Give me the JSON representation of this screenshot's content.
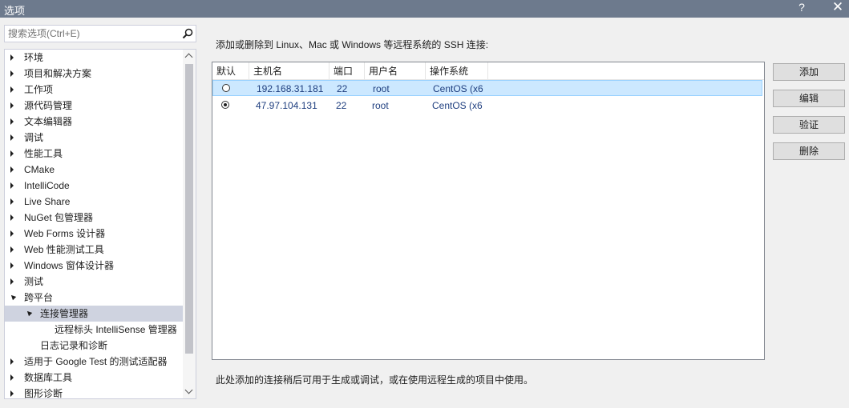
{
  "window": {
    "title": "选项",
    "help": "?",
    "close": "✕"
  },
  "search": {
    "placeholder": "搜索选项(Ctrl+E)",
    "value": ""
  },
  "tree": [
    {
      "label": "环境",
      "state": "collapsed",
      "level": 0
    },
    {
      "label": "项目和解决方案",
      "state": "collapsed",
      "level": 0
    },
    {
      "label": "工作项",
      "state": "collapsed",
      "level": 0
    },
    {
      "label": "源代码管理",
      "state": "collapsed",
      "level": 0
    },
    {
      "label": "文本编辑器",
      "state": "collapsed",
      "level": 0
    },
    {
      "label": "调试",
      "state": "collapsed",
      "level": 0
    },
    {
      "label": "性能工具",
      "state": "collapsed",
      "level": 0
    },
    {
      "label": "CMake",
      "state": "collapsed",
      "level": 0
    },
    {
      "label": "IntelliCode",
      "state": "collapsed",
      "level": 0
    },
    {
      "label": "Live Share",
      "state": "collapsed",
      "level": 0
    },
    {
      "label": "NuGet 包管理器",
      "state": "collapsed",
      "level": 0
    },
    {
      "label": "Web Forms 设计器",
      "state": "collapsed",
      "level": 0
    },
    {
      "label": "Web 性能测试工具",
      "state": "collapsed",
      "level": 0
    },
    {
      "label": "Windows 窗体设计器",
      "state": "collapsed",
      "level": 0
    },
    {
      "label": "测试",
      "state": "collapsed",
      "level": 0
    },
    {
      "label": "跨平台",
      "state": "expanded",
      "level": 0
    },
    {
      "label": "连接管理器",
      "state": "expanded",
      "level": 1,
      "selected": true
    },
    {
      "label": "远程标头 IntelliSense 管理器",
      "state": "none",
      "level": 2
    },
    {
      "label": "日志记录和诊断",
      "state": "none",
      "level": 1
    },
    {
      "label": "适用于 Google Test 的测试适配器",
      "state": "collapsed",
      "level": 0
    },
    {
      "label": "数据库工具",
      "state": "collapsed",
      "level": 0
    },
    {
      "label": "图形诊断",
      "state": "collapsed",
      "level": 0
    }
  ],
  "panel": {
    "description": "添加或删除到 Linux、Mac 或 Windows 等远程系统的 SSH 连接:",
    "columns": [
      "默认",
      "主机名",
      "端口",
      "用户名",
      "操作系统"
    ],
    "rows": [
      {
        "default": false,
        "host": "192.168.31.181",
        "port": "22",
        "user": "root",
        "os": "CentOS (x6",
        "selected": true
      },
      {
        "default": true,
        "host": "47.97.104.131",
        "port": "22",
        "user": "root",
        "os": "CentOS (x6",
        "selected": false
      }
    ],
    "note": "此处添加的连接稍后可用于生成或调试，或在使用远程生成的项目中使用。"
  },
  "buttons": {
    "add": "添加",
    "edit": "编辑",
    "verify": "验证",
    "delete": "删除"
  },
  "icons": {
    "search": "search-icon",
    "close": "close-icon",
    "help": "help-icon"
  }
}
